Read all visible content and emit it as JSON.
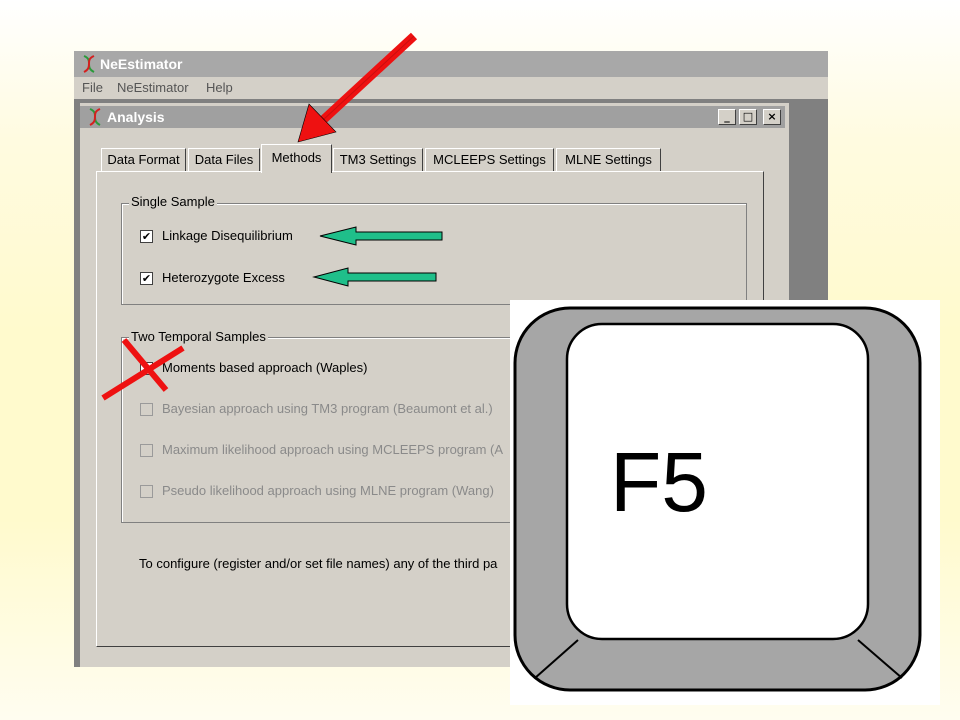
{
  "app": {
    "title": "NeEstimator",
    "menu": [
      "File",
      "NeEstimator",
      "Help"
    ]
  },
  "window": {
    "title": "Analysis",
    "controls": [
      "_",
      "□",
      "×"
    ]
  },
  "tabs": [
    {
      "label": "Data Format",
      "selected": false
    },
    {
      "label": "Data Files",
      "selected": false
    },
    {
      "label": "Methods",
      "selected": true
    },
    {
      "label": "TM3 Settings",
      "selected": false
    },
    {
      "label": "MCLEEPS Settings",
      "selected": false
    },
    {
      "label": "MLNE Settings",
      "selected": false
    }
  ],
  "single_sample": {
    "title": "Single Sample",
    "options": [
      {
        "label": "Linkage Disequilibrium",
        "checked": true
      },
      {
        "label": "Heterozygote Excess",
        "checked": true
      }
    ]
  },
  "temporal": {
    "title": "Two Temporal Samples",
    "options": [
      {
        "label": "Moments based approach (Waples)",
        "checked": false,
        "enabled": true
      },
      {
        "label": "Bayesian approach using TM3 program (Beaumont et al.)",
        "checked": false,
        "enabled": false
      },
      {
        "label": "Maximum likelihood approach using MCLEEPS program (A",
        "checked": false,
        "enabled": false
      },
      {
        "label": "Pseudo likelihood approach using MLNE program (Wang)",
        "checked": false,
        "enabled": false
      }
    ]
  },
  "note": "To configure (register and/or set file names) any of the third pa",
  "key": {
    "label": "F5"
  },
  "annotations": {
    "red_arrow_color": "#ee1111",
    "green_arrow_color": "#1fbf8a",
    "cross_color": "#ee1111"
  }
}
